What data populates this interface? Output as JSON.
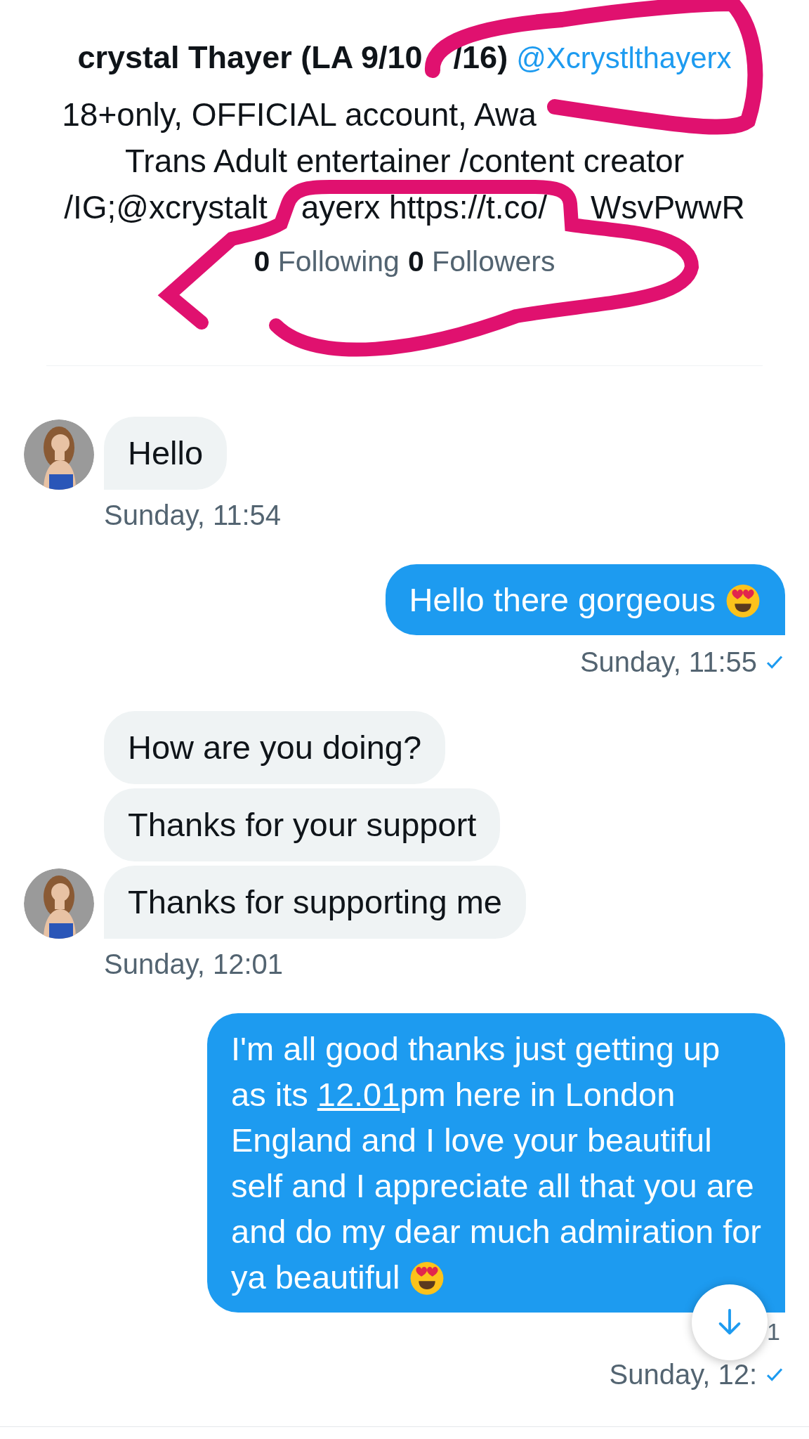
{
  "profile": {
    "name_parts": [
      "crystal Thayer (LA 9/10",
      "/16)"
    ],
    "handle": "@Xcrystlthayerx",
    "bio_lines": [
      [
        "18+only, OFFICIAL account, Awa"
      ],
      [
        "Trans Adult entertainer /content creator"
      ],
      [
        "/IG;@xcrystalt",
        "ayerx https://t.co/",
        "WsvPwwR"
      ]
    ],
    "following_count": "0",
    "following_label": "Following",
    "followers_count": "0",
    "followers_label": "Followers"
  },
  "groups": [
    {
      "kind": "received",
      "time": "Sunday, 11:54",
      "messages": [
        {
          "parts": [
            {
              "text": "Hello"
            }
          ],
          "emoji": false
        }
      ]
    },
    {
      "kind": "sent",
      "time": "Sunday, 11:55",
      "read": true,
      "messages": [
        {
          "parts": [
            {
              "text": "Hello there gorgeous "
            }
          ],
          "emoji": true
        }
      ]
    },
    {
      "kind": "received",
      "time": "Sunday, 12:01",
      "messages": [
        {
          "parts": [
            {
              "text": "How are you doing?"
            }
          ],
          "emoji": false
        },
        {
          "parts": [
            {
              "text": "Thanks for your support"
            }
          ],
          "emoji": false
        },
        {
          "parts": [
            {
              "text": "Thanks for supporting me"
            }
          ],
          "emoji": false
        }
      ]
    },
    {
      "kind": "sent",
      "time": "Sunday, 12:",
      "read": true,
      "messages": [
        {
          "parts": [
            {
              "text": "I'm all good thanks just getting up as its "
            },
            {
              "text": "12.01",
              "kind": "link"
            },
            {
              "text": "pm here in London England and I  love your beautiful self and I appreciate all that you are and do my dear much admiration for ya beautiful "
            }
          ],
          "emoji": true
        }
      ]
    }
  ],
  "scroll_button": {
    "badge": "1"
  }
}
